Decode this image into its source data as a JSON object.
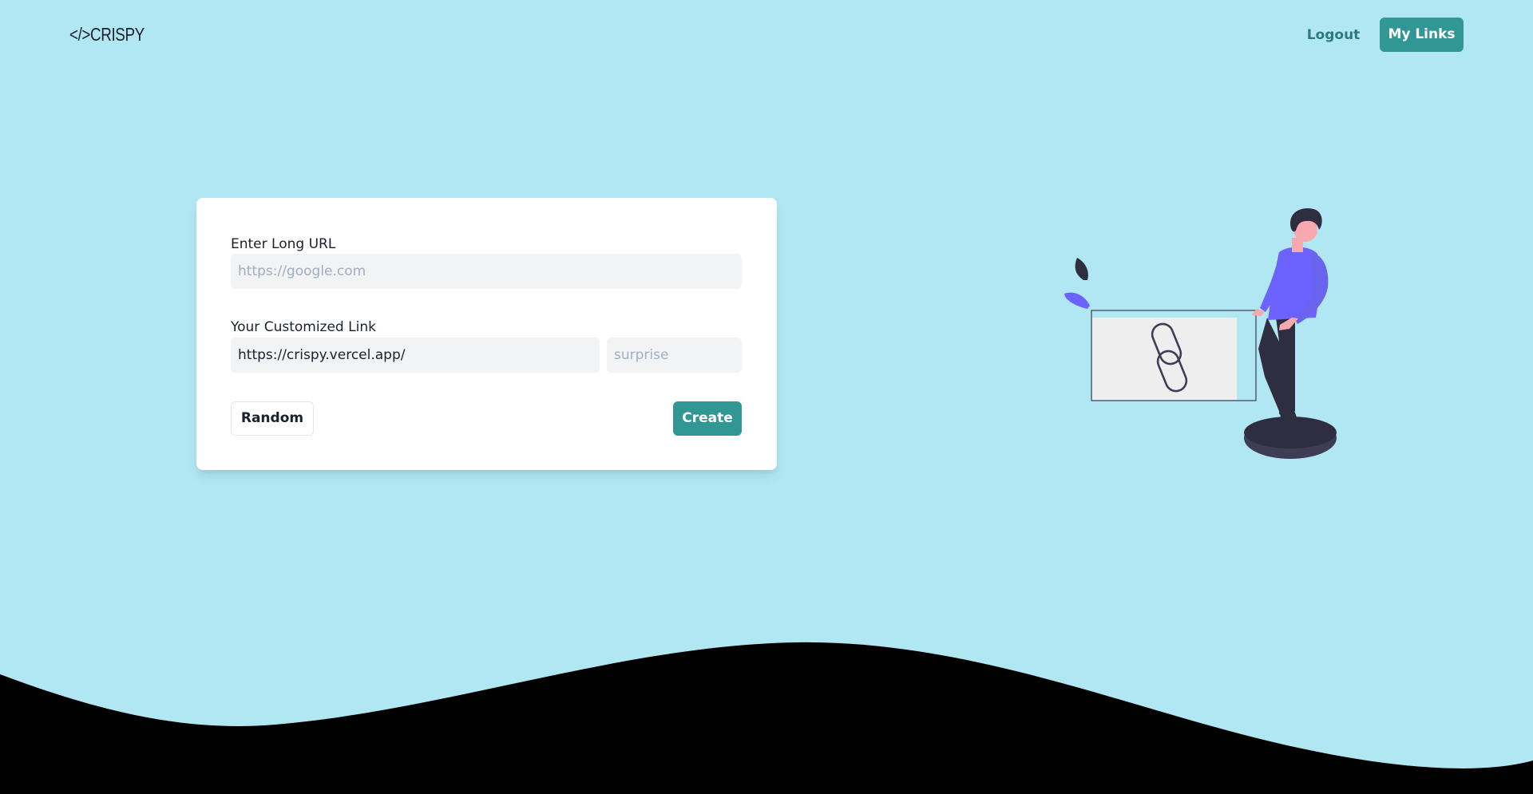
{
  "navbar": {
    "logo_text": "</>CRISPY",
    "logout_label": "Logout",
    "mylinks_label": "My Links"
  },
  "form": {
    "long_url_label": "Enter Long URL",
    "long_url_placeholder": "https://google.com",
    "custom_link_label": "Your Customized Link",
    "base_url_value": "https://crispy.vercel.app/",
    "alias_placeholder": "surprise",
    "random_label": "Random",
    "create_label": "Create"
  },
  "colors": {
    "background": "#b0e7f2",
    "accent": "#319795",
    "accent_text": "#2c7a7b",
    "wave": "#000000",
    "illustration_purple": "#6c63ff"
  },
  "icons": {
    "illustration": "person-with-link-illustration",
    "chain": "chain-link-icon",
    "leaf": "leaf-icon"
  }
}
